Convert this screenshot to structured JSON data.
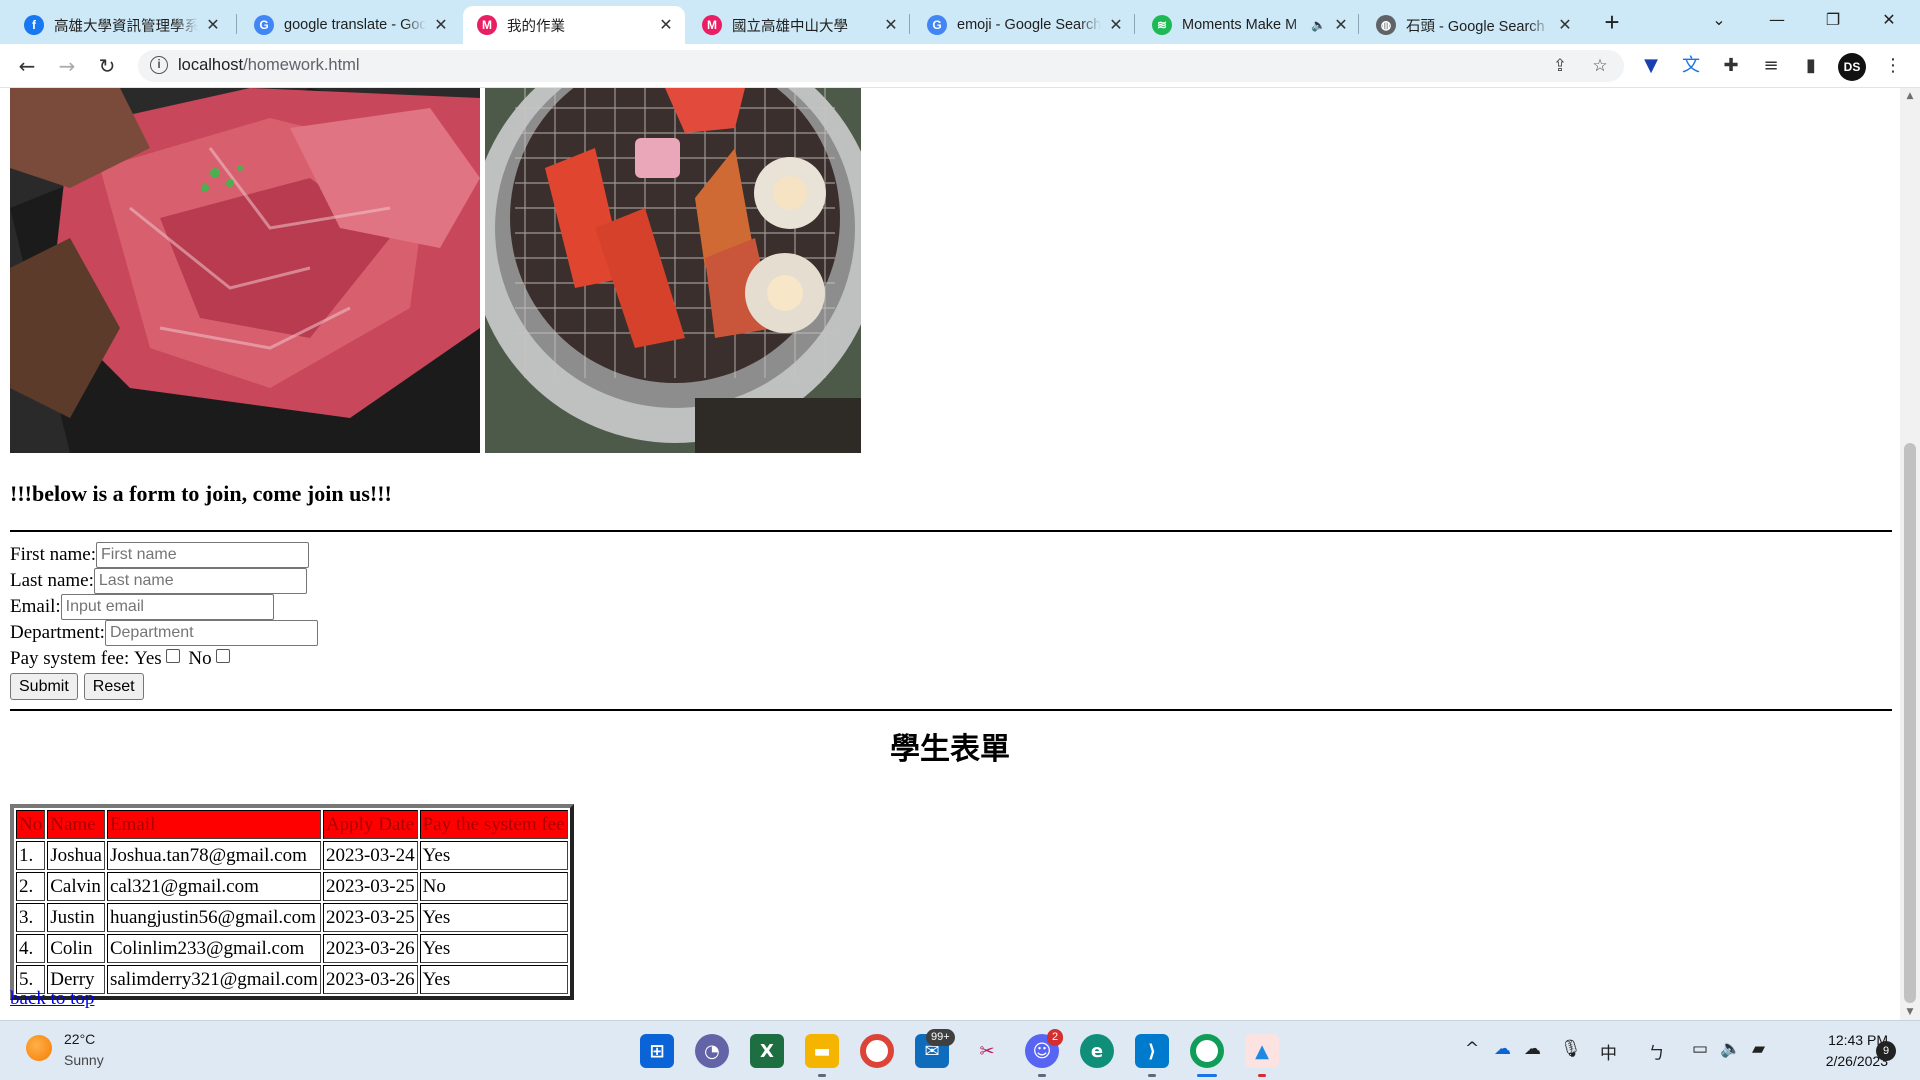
{
  "browser": {
    "tabs": [
      {
        "title": "高雄大學資訊管理學系",
        "favicon": "facebook-icon",
        "color": "#1877f2",
        "glyph": "f"
      },
      {
        "title": "google translate - Goo",
        "favicon": "google-icon",
        "color": "#4285f4",
        "glyph": "G"
      },
      {
        "title": "我的作業",
        "favicon": "site-icon",
        "color": "#e91e63",
        "glyph": "M",
        "active": true
      },
      {
        "title": "國立高雄中山大學",
        "favicon": "site-icon",
        "color": "#e91e63",
        "glyph": "M"
      },
      {
        "title": "emoji - Google Search",
        "favicon": "google-icon",
        "color": "#4285f4",
        "glyph": "G"
      },
      {
        "title": "Moments Make M",
        "favicon": "spotify-icon",
        "color": "#1db954",
        "glyph": "≋"
      },
      {
        "title": "石頭 - Google Search",
        "favicon": "globe-icon",
        "color": "#5f6368",
        "glyph": "◍"
      }
    ],
    "url_host": "localhost",
    "url_path": "/homework.html",
    "profile_initials": "DS"
  },
  "page": {
    "join_heading": "!!!below is a form to join, come join us!!!",
    "form": {
      "first_name_label": "First name:",
      "first_name_placeholder": "First name",
      "last_name_label": "Last name:",
      "last_name_placeholder": "Last name",
      "email_label": "Email:",
      "email_placeholder": "Input email",
      "department_label": "Department:",
      "department_placeholder": "Department",
      "fee_label": "Pay system fee:",
      "fee_yes": "Yes",
      "fee_no": "No",
      "submit": "Submit",
      "reset": "Reset"
    },
    "title": "學生表單",
    "table": {
      "headers": [
        "No",
        "Name",
        "Email",
        "Apply Date",
        "Pay the system fee"
      ],
      "rows": [
        [
          "1.",
          "Joshua",
          "Joshua.tan78@gmail.com",
          "2023-03-24",
          "Yes"
        ],
        [
          "2.",
          "Calvin",
          "cal321@gmail.com",
          "2023-03-25",
          "No"
        ],
        [
          "3.",
          "Justin",
          "huangjustin56@gmail.com",
          "2023-03-25",
          "Yes"
        ],
        [
          "4.",
          "Colin",
          "Colinlim233@gmail.com",
          "2023-03-26",
          "Yes"
        ],
        [
          "5.",
          "Derry",
          "salimderry321@gmail.com",
          "2023-03-26",
          "Yes"
        ]
      ]
    },
    "back_to_top": "back to top"
  },
  "taskbar": {
    "weather_temp": "22°C",
    "weather_desc": "Sunny",
    "mail_badge": "99+",
    "discord_badge": "2",
    "input_lang": "中",
    "time": "12:43 PM",
    "date": "2/26/2023",
    "notifications": "9"
  }
}
